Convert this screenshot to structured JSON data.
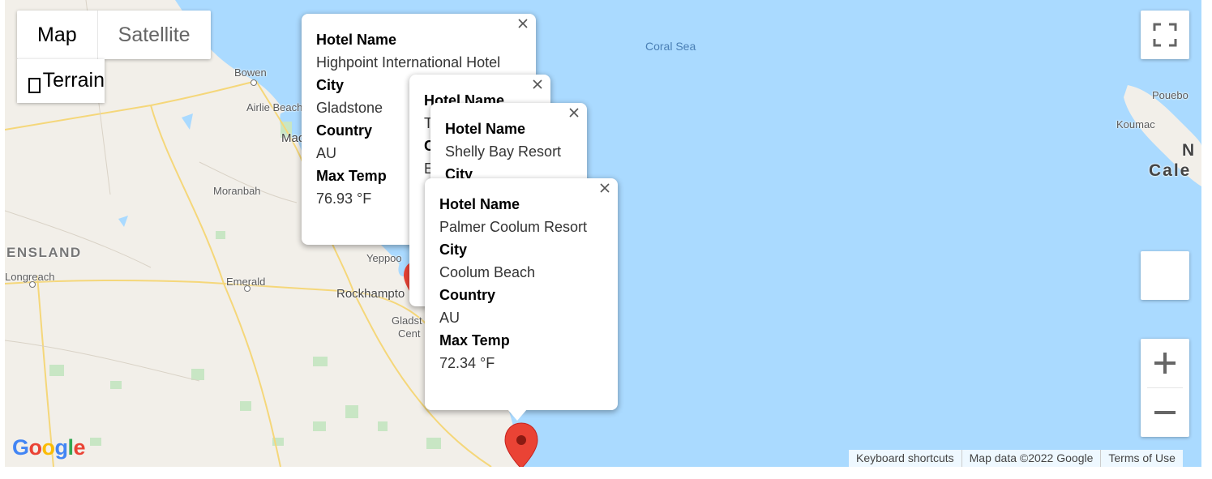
{
  "map_type": {
    "map_label": "Map",
    "satellite_label": "Satellite",
    "terrain_label": "Terrain"
  },
  "labels": {
    "coral_sea": "Coral Sea",
    "bowen": "Bowen",
    "airlie": "Airlie Beach",
    "mackay_partial": "Mac",
    "moranbah": "Moranbah",
    "queensland_partial": "ENSLAND",
    "longreach": "Longreach",
    "emerald": "Emerald",
    "yeppoon_partial": "Yeppoo",
    "rockhampton_partial": "Rockhampto",
    "gladstone_partial": "Gladst",
    "central_partial": "Cent",
    "pouebo": "Pouebo",
    "koumac": "Koumac",
    "new_caledonia_partial_1": "N",
    "new_caledonia_partial_2": "Cale"
  },
  "info_windows": [
    {
      "hotel_key": "Hotel Name",
      "hotel": "Highpoint International Hotel",
      "city_key": "City",
      "city": "Gladstone",
      "country_key": "Country",
      "country": "AU",
      "temp_key": "Max Temp",
      "temp": "76.93 °F"
    },
    {
      "hotel_key": "Hotel Name",
      "hotel_partial": "T",
      "city_partial": "C",
      "country_partial": "E"
    },
    {
      "hotel_key": "Hotel Name",
      "hotel": "Shelly Bay Resort",
      "city_key": "City"
    },
    {
      "hotel_key": "Hotel Name",
      "hotel": "Palmer Coolum Resort",
      "city_key": "City",
      "city": "Coolum Beach",
      "country_key": "Country",
      "country": "AU",
      "temp_key": "Max Temp",
      "temp": "72.34 °F"
    }
  ],
  "icons": {
    "close": "close-icon",
    "fullscreen": "fullscreen-icon",
    "zoom_in": "plus-icon",
    "zoom_out": "minus-icon",
    "marker": "map-marker-icon"
  },
  "logo": "Google",
  "attribution": {
    "shortcuts": "Keyboard shortcuts",
    "map_data": "Map data ©2022 Google",
    "terms": "Terms of Use"
  },
  "colors": {
    "water": "#aadaff",
    "land": "#f2efe9",
    "park": "#c8e6c4",
    "road": "#f5d77a",
    "marker": "#ea4335"
  }
}
